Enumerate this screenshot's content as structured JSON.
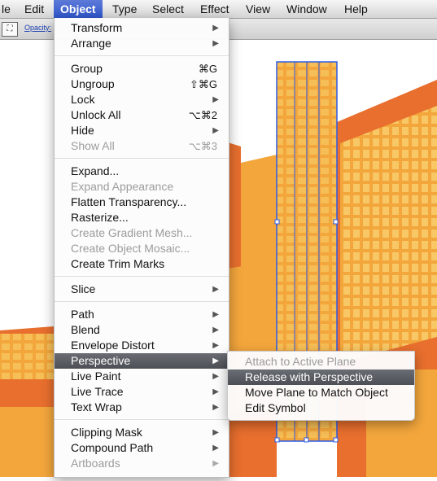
{
  "menubar": {
    "items": [
      {
        "label": "le"
      },
      {
        "label": "Edit"
      },
      {
        "label": "Object"
      },
      {
        "label": "Type"
      },
      {
        "label": "Select"
      },
      {
        "label": "Effect"
      },
      {
        "label": "View"
      },
      {
        "label": "Window"
      },
      {
        "label": "Help"
      }
    ]
  },
  "controlbar": {
    "opacity_label": "Opacity:",
    "icon": "transform-icon"
  },
  "object_menu": {
    "items": [
      {
        "label": "Transform",
        "submenu": true
      },
      {
        "label": "Arrange",
        "submenu": true
      },
      {
        "label": "Group",
        "shortcut": "⌘G"
      },
      {
        "label": "Ungroup",
        "shortcut": "⇧⌘G"
      },
      {
        "label": "Lock",
        "submenu": true
      },
      {
        "label": "Unlock All",
        "shortcut": "⌥⌘2"
      },
      {
        "label": "Hide",
        "submenu": true
      },
      {
        "label": "Show All",
        "shortcut": "⌥⌘3",
        "disabled": true
      },
      {
        "label": "Expand..."
      },
      {
        "label": "Expand Appearance",
        "disabled": true
      },
      {
        "label": "Flatten Transparency..."
      },
      {
        "label": "Rasterize..."
      },
      {
        "label": "Create Gradient Mesh...",
        "disabled": true
      },
      {
        "label": "Create Object Mosaic...",
        "disabled": true
      },
      {
        "label": "Create Trim Marks"
      },
      {
        "label": "Slice",
        "submenu": true
      },
      {
        "label": "Path",
        "submenu": true
      },
      {
        "label": "Blend",
        "submenu": true
      },
      {
        "label": "Envelope Distort",
        "submenu": true
      },
      {
        "label": "Perspective",
        "submenu": true,
        "highlighted": true
      },
      {
        "label": "Live Paint",
        "submenu": true
      },
      {
        "label": "Live Trace",
        "submenu": true
      },
      {
        "label": "Text Wrap",
        "submenu": true
      },
      {
        "label": "Clipping Mask",
        "submenu": true
      },
      {
        "label": "Compound Path",
        "submenu": true
      },
      {
        "label": "Artboards",
        "submenu": true,
        "disabled": true
      }
    ]
  },
  "perspective_menu": {
    "items": [
      {
        "label": "Attach to Active Plane",
        "disabled": true
      },
      {
        "label": "Release with Perspective",
        "highlighted": true
      },
      {
        "label": "Move Plane to Match Object"
      },
      {
        "label": "Edit Symbol"
      }
    ]
  },
  "colors": {
    "orange": "#e86f2e",
    "light_orange": "#f3a63c",
    "window_grid": "#f7c25a",
    "selection_blue": "#2e5ce6"
  }
}
